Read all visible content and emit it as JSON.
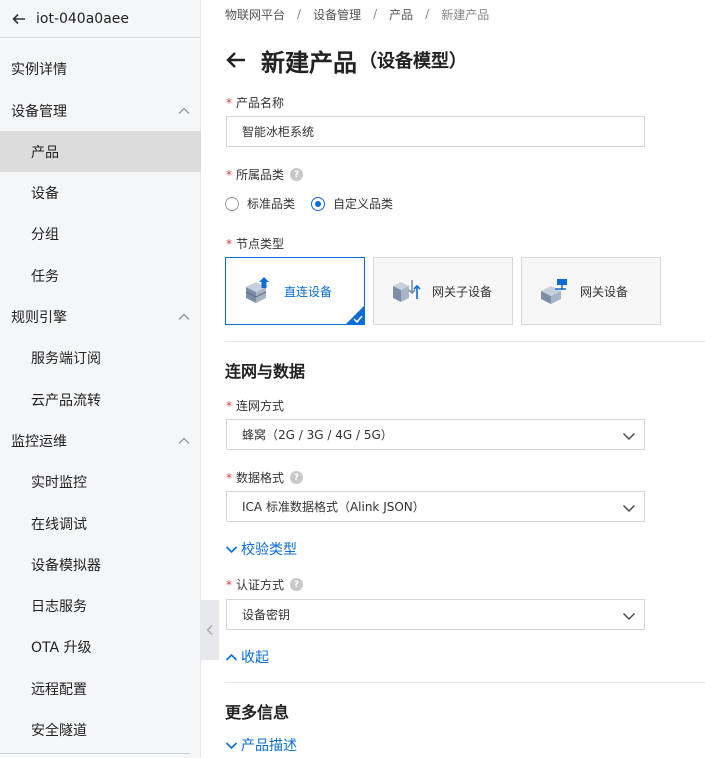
{
  "sidebar": {
    "title": "iot-040a0aee",
    "items": [
      {
        "label": "实例详情"
      },
      {
        "label": "设备管理"
      },
      {
        "label": "产品"
      },
      {
        "label": "设备"
      },
      {
        "label": "分组"
      },
      {
        "label": "任务"
      },
      {
        "label": "规则引擎"
      },
      {
        "label": "服务端订阅"
      },
      {
        "label": "云产品流转"
      },
      {
        "label": "监控运维"
      },
      {
        "label": "实时监控"
      },
      {
        "label": "在线调试"
      },
      {
        "label": "设备模拟器"
      },
      {
        "label": "日志服务"
      },
      {
        "label": "OTA 升级"
      },
      {
        "label": "远程配置"
      },
      {
        "label": "安全隧道"
      }
    ]
  },
  "breadcrumb": [
    "物联网平台",
    "设备管理",
    "产品",
    "新建产品"
  ],
  "page": {
    "title": "新建产品",
    "subtitle": "（设备模型）"
  },
  "form": {
    "product_name": {
      "label": "产品名称",
      "value": "智能冰柜系统"
    },
    "category": {
      "label": "所属品类",
      "options": [
        "标准品类",
        "自定义品类"
      ],
      "selected": "自定义品类"
    },
    "node_type": {
      "label": "节点类型",
      "options": [
        "直连设备",
        "网关子设备",
        "网关设备"
      ],
      "selected": "直连设备"
    },
    "section_network": "连网与数据",
    "network_method": {
      "label": "连网方式",
      "value": "蜂窝（2G / 3G / 4G / 5G）"
    },
    "data_format": {
      "label": "数据格式",
      "value": "ICA 标准数据格式（Alink JSON）"
    },
    "check_type_link": "校验类型",
    "auth_method": {
      "label": "认证方式",
      "value": "设备密钥"
    },
    "collapse_link": "收起",
    "section_more": "更多信息",
    "product_desc_link": "产品描述"
  },
  "colors": {
    "accent": "#0a6cd6",
    "required": "#e23b3b",
    "sidebar_bg": "#f5f6f8",
    "sidebar_active": "#dcdcdc"
  }
}
